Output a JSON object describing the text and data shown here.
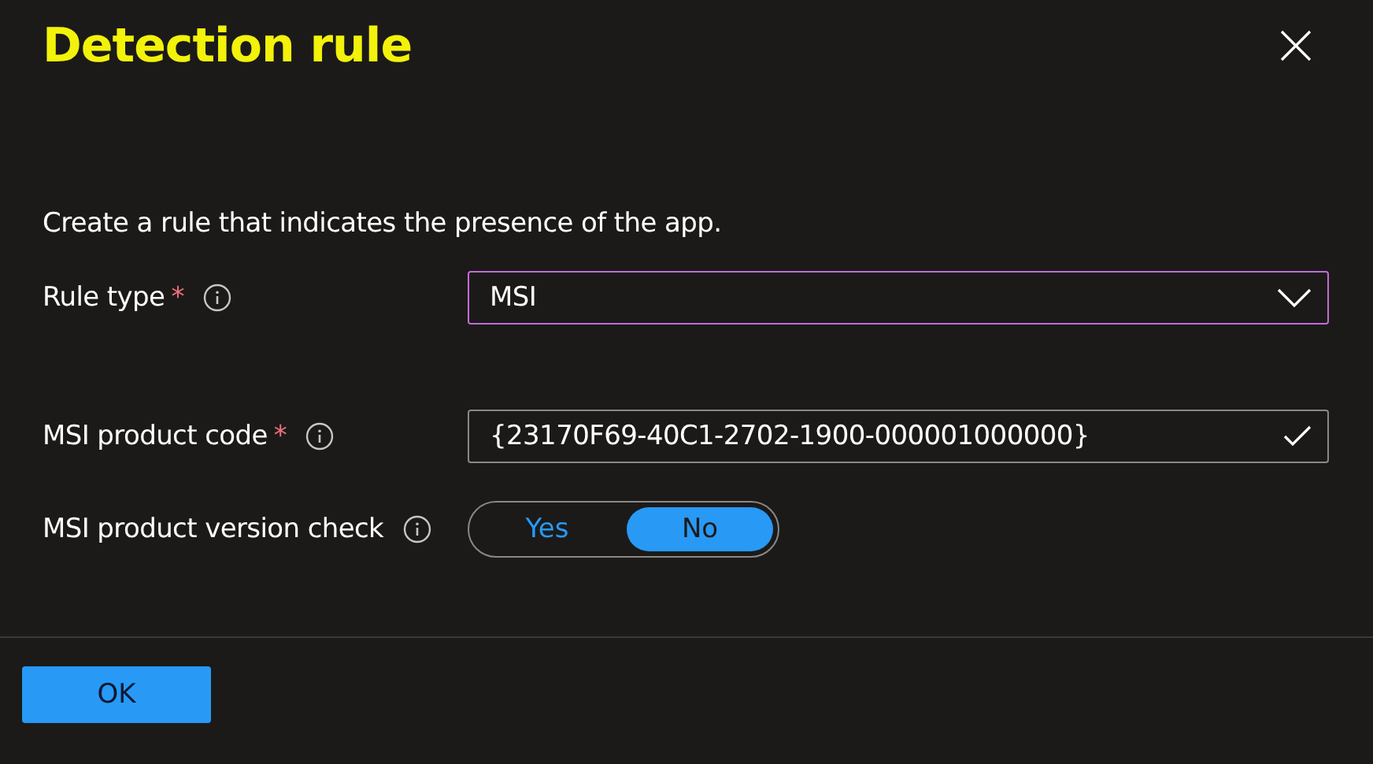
{
  "title": "Detection rule",
  "description": "Create a rule that indicates the presence of the app.",
  "fields": [
    {
      "kind": "dropdown",
      "label": "Rule type",
      "required_mark": "*",
      "value": "MSI",
      "focused": true
    },
    {
      "kind": "text",
      "label": "MSI product code",
      "required_mark": "*",
      "value": "{23170F69-40C1-2702-1900-000001000000}",
      "valid": true
    },
    {
      "kind": "toggle",
      "label": "MSI product version check",
      "options": [
        {
          "label": "Yes",
          "selected": false
        },
        {
          "label": "No",
          "selected": true
        }
      ]
    }
  ],
  "buttons": [
    "OK"
  ]
}
